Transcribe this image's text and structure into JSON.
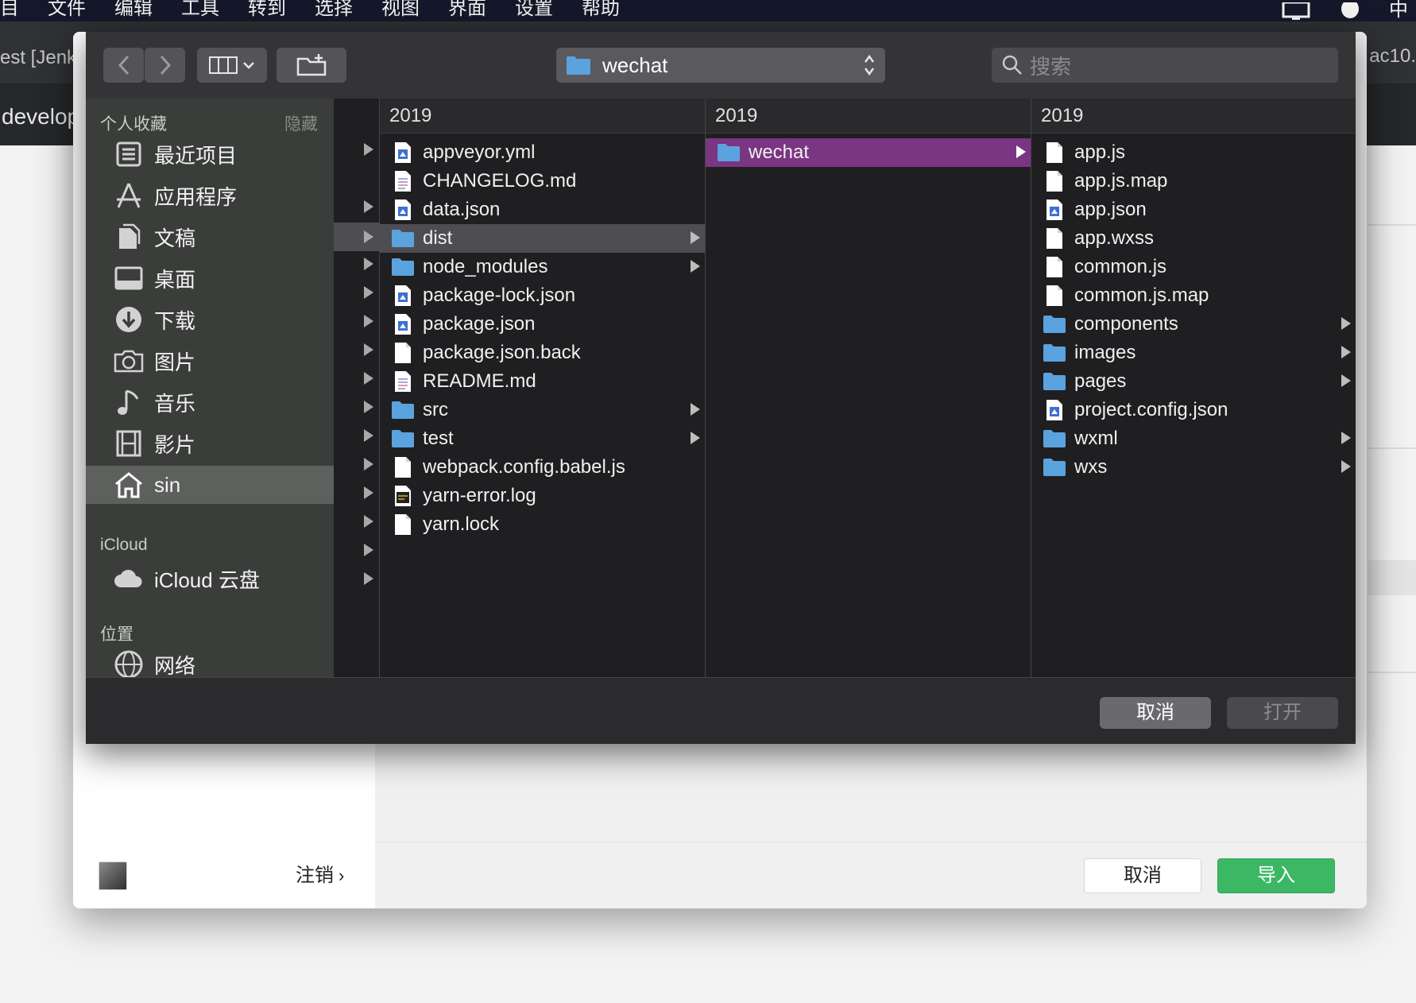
{
  "menubar": {
    "items": [
      "目",
      "文件",
      "编辑",
      "工具",
      "转到",
      "选择",
      "视图",
      "界面",
      "设置",
      "帮助"
    ],
    "right_item": "中"
  },
  "background": {
    "tab_left": "est [Jenk",
    "tab_left2": "develop",
    "tab_right": "ac10.",
    "logout": "注销",
    "cancel": "取消",
    "import": "导入"
  },
  "toolbar": {
    "path": "wechat",
    "search_placeholder": "搜索"
  },
  "sidebar": {
    "favorites_heading": "个人收藏",
    "hide_label": "隐藏",
    "favorites": [
      {
        "label": "最近项目",
        "icon": "recents-icon"
      },
      {
        "label": "应用程序",
        "icon": "applications-icon"
      },
      {
        "label": "文稿",
        "icon": "documents-icon"
      },
      {
        "label": "桌面",
        "icon": "desktop-icon"
      },
      {
        "label": "下载",
        "icon": "downloads-icon"
      },
      {
        "label": "图片",
        "icon": "pictures-icon"
      },
      {
        "label": "音乐",
        "icon": "music-icon"
      },
      {
        "label": "影片",
        "icon": "movies-icon"
      },
      {
        "label": "sin",
        "icon": "home-icon",
        "selected": true
      }
    ],
    "icloud_heading": "iCloud",
    "icloud_drive": "iCloud 云盘",
    "locations_heading": "位置",
    "network": "网络"
  },
  "columns": [
    {
      "header": "2019",
      "items": [
        {
          "name": "appveyor.yml",
          "type": "doc"
        },
        {
          "name": "CHANGELOG.md",
          "type": "text"
        },
        {
          "name": "data.json",
          "type": "doc"
        },
        {
          "name": "dist",
          "type": "folder",
          "highlighted": true
        },
        {
          "name": "node_modules",
          "type": "folder"
        },
        {
          "name": "package-lock.json",
          "type": "doc"
        },
        {
          "name": "package.json",
          "type": "doc"
        },
        {
          "name": "package.json.back",
          "type": "file"
        },
        {
          "name": "README.md",
          "type": "text"
        },
        {
          "name": "src",
          "type": "folder"
        },
        {
          "name": "test",
          "type": "folder"
        },
        {
          "name": "webpack.config.babel.js",
          "type": "file"
        },
        {
          "name": "yarn-error.log",
          "type": "log"
        },
        {
          "name": "yarn.lock",
          "type": "file"
        }
      ]
    },
    {
      "header": "2019",
      "items": [
        {
          "name": "wechat",
          "type": "folder",
          "selected": true
        }
      ]
    },
    {
      "header": "2019",
      "items": [
        {
          "name": "app.js",
          "type": "file"
        },
        {
          "name": "app.js.map",
          "type": "file"
        },
        {
          "name": "app.json",
          "type": "doc"
        },
        {
          "name": "app.wxss",
          "type": "file"
        },
        {
          "name": "common.js",
          "type": "file"
        },
        {
          "name": "common.js.map",
          "type": "file"
        },
        {
          "name": "components",
          "type": "folder"
        },
        {
          "name": "images",
          "type": "folder"
        },
        {
          "name": "pages",
          "type": "folder"
        },
        {
          "name": "project.config.json",
          "type": "doc"
        },
        {
          "name": "wxml",
          "type": "folder"
        },
        {
          "name": "wxs",
          "type": "folder"
        }
      ]
    }
  ],
  "footer": {
    "cancel": "取消",
    "open": "打开"
  },
  "colors": {
    "selection": "#7a3583",
    "folder": "#5aa3de",
    "import_green": "#3cb865"
  }
}
